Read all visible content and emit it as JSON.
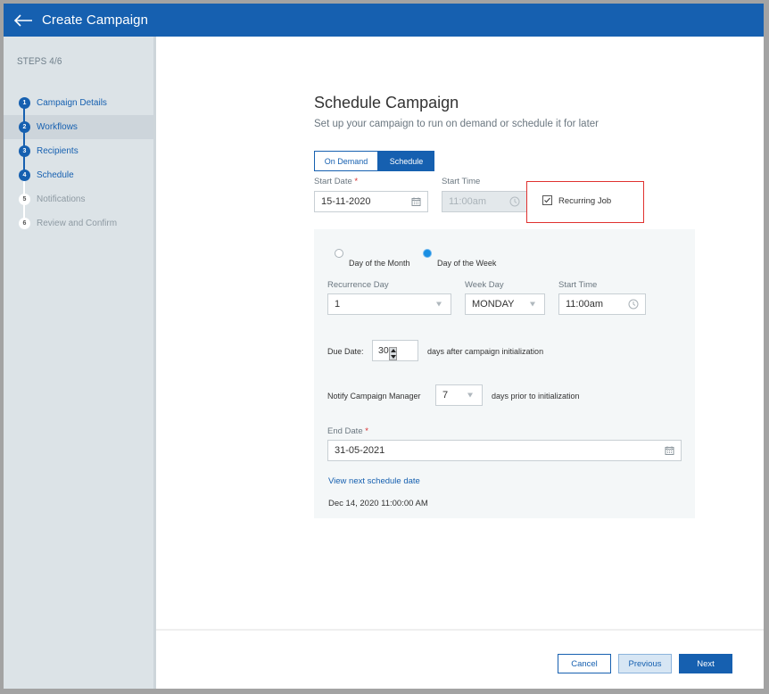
{
  "header": {
    "title": "Create Campaign",
    "back_icon": "arrow-left-icon"
  },
  "sidebar": {
    "steps_label": "STEPS 4/6",
    "current_step": 4,
    "total_steps": 6,
    "steps": [
      {
        "number": "1",
        "label": "Campaign Details",
        "state": "done"
      },
      {
        "number": "2",
        "label": "Workflows",
        "state": "done",
        "hovered": true
      },
      {
        "number": "3",
        "label": "Recipients",
        "state": "done"
      },
      {
        "number": "4",
        "label": "Schedule",
        "state": "current"
      },
      {
        "number": "5",
        "label": "Notifications",
        "state": "todo"
      },
      {
        "number": "6",
        "label": "Review and Confirm",
        "state": "todo"
      }
    ]
  },
  "main": {
    "title": "Schedule Campaign",
    "subtitle": "Set up your campaign to run on demand or schedule it for later",
    "mode_toggle": {
      "options": [
        "On Demand",
        "Schedule"
      ],
      "selected": "Schedule"
    },
    "start_date": {
      "label": "Start Date",
      "required_mark": "*",
      "value": "15-11-2020",
      "icon": "calendar-icon"
    },
    "start_time": {
      "label": "Start Time",
      "value": "11:00am",
      "disabled": true,
      "icon": "clock-icon"
    },
    "recurring_job": {
      "label": "Recurring Job",
      "checked": true
    },
    "recurrence": {
      "radio_options": [
        "Day of the Month",
        "Day of the Week"
      ],
      "selected_option": "Day of the Week",
      "recurrence_day": {
        "label": "Recurrence Day",
        "value": "1"
      },
      "week_day": {
        "label": "Week Day",
        "value": "MONDAY"
      },
      "start_time": {
        "label": "Start Time",
        "value": "11:00am",
        "icon": "clock-icon"
      },
      "due_date": {
        "label": "Due Date:",
        "value": "30",
        "suffix": "days after campaign initialization"
      },
      "notify": {
        "label": "Notify Campaign Manager",
        "value": "7",
        "suffix": "days prior to initialization"
      },
      "end_date": {
        "label": "End Date",
        "required_mark": "*",
        "value": "31-05-2021",
        "icon": "calendar-icon"
      },
      "view_next_link": "View next schedule date",
      "next_schedule_date": "Dec 14, 2020 11:00:00 AM"
    }
  },
  "footer": {
    "cancel_label": "Cancel",
    "previous_label": "Previous",
    "next_label": "Next"
  },
  "colors": {
    "brand": "#1660b0",
    "highlight": "#e0312f",
    "radio_active": "#1a8fe3"
  }
}
